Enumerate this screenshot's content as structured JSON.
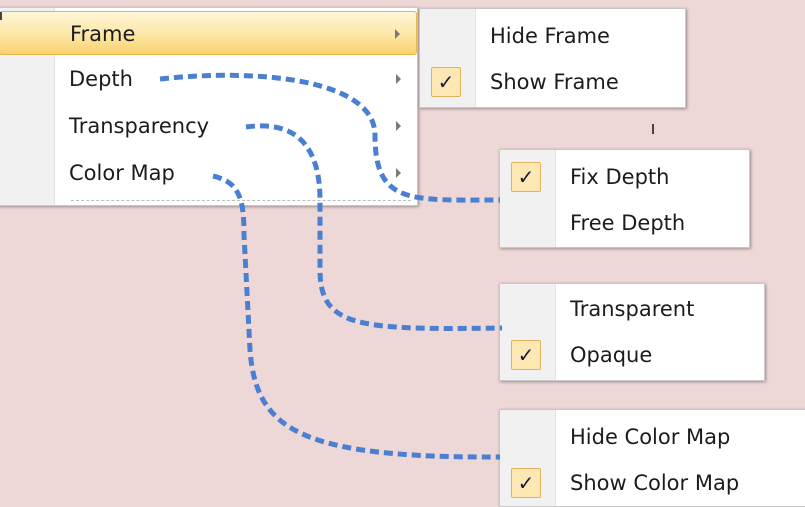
{
  "main_menu": {
    "items": [
      {
        "label": "Frame",
        "highlighted": true
      },
      {
        "label": "Depth",
        "highlighted": false
      },
      {
        "label": "Transparency",
        "highlighted": false
      },
      {
        "label": "Color Map",
        "highlighted": false
      }
    ]
  },
  "submenus": {
    "frame": {
      "items": [
        {
          "label": "Hide Frame",
          "checked": false
        },
        {
          "label": "Show Frame",
          "checked": true
        }
      ]
    },
    "depth": {
      "items": [
        {
          "label": "Fix Depth",
          "checked": true
        },
        {
          "label": "Free Depth",
          "checked": false
        }
      ]
    },
    "transparency": {
      "items": [
        {
          "label": "Transparent",
          "checked": false
        },
        {
          "label": "Opaque",
          "checked": true
        }
      ]
    },
    "color_map": {
      "items": [
        {
          "label": "Hide Color Map",
          "checked": false
        },
        {
          "label": "Show Color Map",
          "checked": true
        }
      ]
    }
  },
  "icons": {
    "check": "✓",
    "submenu_arrow": "chevron-right-icon"
  },
  "colors": {
    "background": "#eed8d7",
    "connector": "#4a7fd1",
    "highlight": "#fde7a6",
    "check_box": "#fde8b3"
  }
}
